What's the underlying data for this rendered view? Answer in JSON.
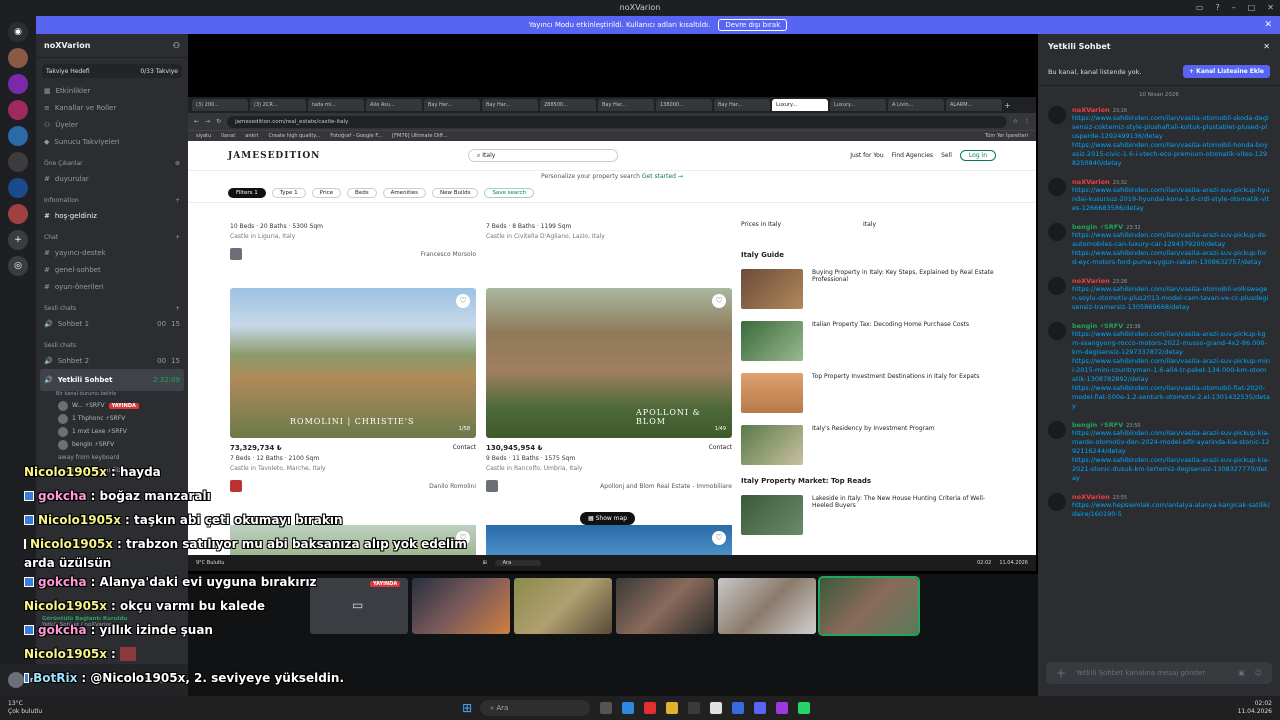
{
  "window": {
    "title": "noXVarion"
  },
  "banner": {
    "text": "Yayıncı Modu etkinleştirildi. Kullanıcı adları kısaltıldı.",
    "button": "Devre dışı bırak"
  },
  "server": {
    "name": "noXVarion",
    "boost_label": "Takviye Hedefi",
    "boost_count": "0/33 Takviye"
  },
  "channels": {
    "top_items": [
      "Etkinlikler",
      "Kanallar ve Roller",
      "Üyeler",
      "Sunucu Takviyeleri"
    ],
    "featured_label": "Öne Çıkanlar",
    "featured": [
      "duyurular"
    ],
    "info_label": "Information",
    "info": [
      "hoş-geldiniz"
    ],
    "chat_label": "Chat",
    "chat": [
      "yayıncı-destek",
      "genel-sohbet",
      "oyun-önerileri"
    ],
    "voice_label_1": "Sesli chats",
    "voice_1": {
      "name": "Sohbet 1",
      "count_a": "00",
      "count_b": "15"
    },
    "voice_label_2": "Sesli chats",
    "voice_2": {
      "name": "Sohbet 2",
      "count_a": "00",
      "count_b": "15"
    },
    "active_channel": {
      "name": "Yetkili Sohbet",
      "sub": "Bir kanal durumu belirle",
      "timer": "2:32:09"
    },
    "voice_users": [
      {
        "name": "W... ⚡SRFV",
        "live": "YAYINDA"
      },
      {
        "name": "1 Thphonc ⚡SRFV"
      },
      {
        "name": "1 mxt Lexe ⚡SRFV"
      },
      {
        "name": "bengin ⚡SRFV"
      }
    ],
    "away_text": "away from keyboard",
    "voice_connected": "Ses Kanallarını Gizle",
    "conn_status": "Görüntülü Bağlantı Kuruldu",
    "conn_sub": "Yetkili Sohbet / noXVarion"
  },
  "user": {
    "name": "noXVarion",
    "weather_temp": "13°C",
    "weather_desc": "Çok bulutlu"
  },
  "browser": {
    "tabs": [
      "(3) 200...",
      "(3) 2CR...",
      "tada mi...",
      "Aile Asu...",
      "Bay Har...",
      "Bay Har...",
      "288500...",
      "Bay Har...",
      "138000...",
      "Bay Har...",
      "Luxury...",
      "Luxury...",
      "A Livin...",
      "ALARM..."
    ],
    "active_tab": 10,
    "url": "jamesedition.com/real_estate/castle-italy",
    "bookmarks": [
      "siyatu",
      "Ilanat",
      "ankrt",
      "Create high quality...",
      "Fotoğraf - Google F...",
      "[FM76] Ultimate Diff..."
    ],
    "bookmarks_right": "Tüm Yer İşaretleri"
  },
  "site": {
    "logo": "JAMESEDITION",
    "search_value": "Italy",
    "nav": [
      "Just for You",
      "Find Agencies",
      "Sell"
    ],
    "login": "Log in",
    "personalize": "Personalize your property search",
    "get_started": "Get started →",
    "filters": [
      "Filters 1",
      "Type 1",
      "Price",
      "Beds",
      "Amenities",
      "New Builds",
      "Save search"
    ],
    "top_cards": [
      {
        "meta": "10 Beds · 20 Baths · 5300 Sqm",
        "loc": "Castle in Liguria, Italy",
        "agent": "Francesco Morsolo"
      },
      {
        "meta": "7 Beds · 8 Baths · 1199 Sqm",
        "loc": "Castle in Civitella D'Agliano, Lazio, Italy",
        "agent": ""
      }
    ],
    "cards": [
      {
        "price": "73,329,734 ₺",
        "contact": "Contact",
        "meta": "7 Beds · 12 Baths · 2100 Sqm",
        "loc": "Castle in Tavoleto, Marche, Italy",
        "agent": "Danilo Romolini",
        "watermark": "ROMOLINI | CHRISTIE'S",
        "counter": "1/58"
      },
      {
        "price": "130,945,954 ₺",
        "contact": "Contact",
        "meta": "9 Beds · 11 Baths · 1575 Sqm",
        "loc": "Castle in Rancolfo, Umbria, Italy",
        "agent": "Apollonj and Blom Real Estate - Immobiliare",
        "watermark": "APOLLONI & BLOM",
        "counter": "1/49"
      }
    ],
    "prices_label": "Prices in Italy",
    "prices_value": "Italy",
    "guide_title": "Italy Guide",
    "guide": [
      "Buying Property in Italy: Key Steps, Explained by Real Estate Professional",
      "Italian Property Tax: Decoding Home Purchase Costs",
      "Top Property Investment Destinations in Italy for Expats",
      "Italy's Residency by Investment Program"
    ],
    "market_title": "Italy Property Market: Top Reads",
    "market": [
      "Lakeside in Italy: The New House Hunting Criteria of Well-Heeled Buyers"
    ],
    "show_map": "Show map"
  },
  "stream_taskbar": {
    "search": "Ara",
    "weather": "9°C Bulutlu",
    "time": "02:02",
    "date": "11.04.2026"
  },
  "right_panel": {
    "title": "Yetkili Sohbet",
    "info": "Bu kanal, kanal listende yok.",
    "add_button": "+ Kanal Listesine Ekle",
    "date": "10 Nisan 2026",
    "messages": [
      {
        "name": "noXVarion",
        "color": "#f23f43",
        "time": "23:16",
        "links": [
          "https://www.sahibinden.com/ilan/vasita-otomobil-skoda-degisensiz-coktemiz-style-plushaftali-koltuk-plustablet-plused-plusperde-1292499136/detay",
          "https://www.sahibinden.com/ilan/vasita-otomobil-honda-boyasiz-2015-civic-1.6-i-vtech-eco-premium-otomatik-vites-1298250840/detay"
        ]
      },
      {
        "name": "noXVarion",
        "color": "#f23f43",
        "time": "23:32",
        "links": [
          "https://www.sahibinden.com/ilan/vasita-arazi-suv-pickup-hyundai-kusursuz-2019-hyundai-kona-1.6-crdi-style-otomatik-vites-1266683586/detay"
        ]
      },
      {
        "name": "bengin ⚡SRFV",
        "color": "#23a55a",
        "time": "23:32",
        "links": [
          "https://www.sahibinden.com/ilan/vasita-arazi-suv-pickup-ds-automobiles-can-luxury-car-1294379200/detay",
          "https://www.sahibinden.com/ilan/vasita-arazi-suv-pickup-ford-eyc-motors-ford-puma-uygun-rakam-1308632757/detay"
        ]
      },
      {
        "name": "noXVarion",
        "color": "#f23f43",
        "time": "23:28",
        "links": [
          "https://www.sahibinden.com/ilan/vasita-otomobil-volkswagen-soylu-otomotiv-plus2013-model-cam-tavan-ve-cc-plusdegisensiz-tramersiz-1305869668/detay"
        ]
      },
      {
        "name": "bengin ⚡SRFV",
        "color": "#23a55a",
        "time": "23:38",
        "links": [
          "https://www.sahibinden.com/ilan/vasita-arazi-suv-pickup-kgm-ssangyong-rocco-motors-2022-musso-grand-4x2-86.000-km-degisensiz-1297337872/detay",
          "https://www.sahibinden.com/ilan/vasita-arazi-suv-pickup-mini-2015-mini-countryman-1.6-all4-tr-paket-134.000-km-otomatik-1308782892/detay",
          "https://www.sahibinden.com/ilan/vasita-otomobil-fiat-2020-model-fiat-500e-1.2-senturk-otomotiv-2.el-1301432535/detay"
        ]
      },
      {
        "name": "bengin ⚡SRFV",
        "color": "#23a55a",
        "time": "23:50",
        "links": [
          "https://www.sahibinden.com/ilan/vasita-arazi-suv-pickup-kia-marde-otomotiv-den-2024-model-sifir-ayarinda-kia-stonic-1292116244/detay",
          "https://www.sahibinden.com/ilan/vasita-arazi-suv-pickup-kia-2021-stonic-dusuk-km-tertemiz-degisensiz-1308327770/detay"
        ]
      },
      {
        "name": "noXVarion",
        "color": "#f23f43",
        "time": "23:55",
        "links": [
          "https://www.hepsiemlak.com/antalya-alanya-kargicak-satilik/daire/160190-5"
        ]
      }
    ],
    "input_placeholder": "Yetkili Sohbet kanalına mesaj gönder"
  },
  "overlay_chat": [
    {
      "name": "Nicolo1905x",
      "cls": "",
      "text": ": hayda"
    },
    {
      "name": "gokcha",
      "cls": "g",
      "text": ": boğaz manzaralı"
    },
    {
      "name": "Nicolo1905x",
      "cls": "",
      "text": ": taşkın abi çeti okumayı bırakın"
    },
    {
      "name": "Nicolo1905x",
      "cls": "",
      "text": ": trabzon satılıyor mu abi baksanıza alıp yok edelim"
    },
    {
      "name": "",
      "cls": "",
      "text": "arda üzülsün"
    },
    {
      "name": "gokcha",
      "cls": "g",
      "text": ": Alanya'daki evi uyguna bırakırız"
    },
    {
      "name": "Nicolo1905x",
      "cls": "",
      "text": ": okçu varmı bu kalede"
    },
    {
      "name": "gokcha",
      "cls": "g",
      "text": ": yıllık izinde şuan"
    },
    {
      "name": "Nicolo1905x",
      "cls": "",
      "text": ":"
    },
    {
      "name": "BotRix",
      "cls": "b",
      "text": ": @Nicolo1905x, 2. seviyeye yükseldin."
    }
  ],
  "cams": [
    {
      "live": "YAYINDA"
    },
    {},
    {},
    {},
    {},
    {}
  ],
  "taskbar": {
    "weather_temp": "13°C",
    "weather_desc": "Çok bulutlu",
    "search": "Ara",
    "time": "02:02",
    "date": "11.04.2026"
  }
}
